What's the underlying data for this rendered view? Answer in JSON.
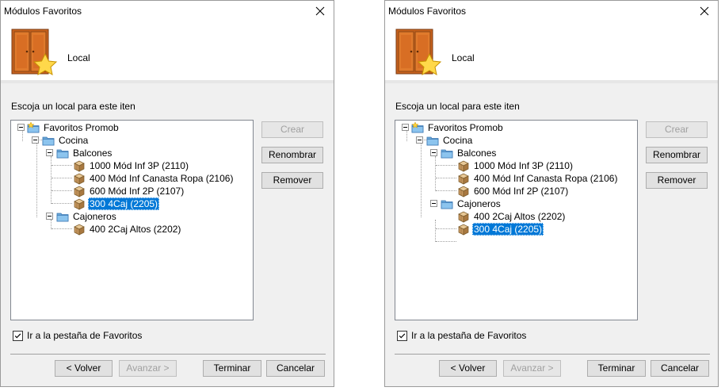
{
  "left_dialog": {
    "title": "Módulos Favoritos",
    "local_label": "Local",
    "instruction": "Escoja un local para este iten",
    "tree": {
      "root": "Favoritos Promob",
      "cocina": "Cocina",
      "balcones": "Balcones",
      "balcones_items": [
        "1000 Mód Inf 3P (2110)",
        "400 Mód Inf Canasta Ropa (2106)",
        "600 Mód Inf 2P (2107)",
        "300 4Caj (2205)"
      ],
      "cajoneros": "Cajoneros",
      "cajoneros_items": [
        "400 2Caj Altos (2202)"
      ],
      "selected": "300 4Caj (2205)"
    },
    "buttons": {
      "crear": "Crear",
      "renombrar": "Renombrar",
      "remover": "Remover"
    },
    "checkbox": {
      "label": "Ir a la pestaña de Favoritos",
      "checked": true
    },
    "footer": {
      "volver": "< Volver",
      "avanzar": "Avanzar >",
      "terminar": "Terminar",
      "cancelar": "Cancelar"
    }
  },
  "right_dialog": {
    "title": "Módulos Favoritos",
    "local_label": "Local",
    "instruction": "Escoja un local para este iten",
    "tree": {
      "root": "Favoritos Promob",
      "cocina": "Cocina",
      "balcones": "Balcones",
      "balcones_items": [
        "1000 Mód Inf 3P (2110)",
        "400 Mód Inf Canasta Ropa (2106)",
        "600 Mód Inf 2P (2107)"
      ],
      "cajoneros": "Cajoneros",
      "cajoneros_items": [
        "400 2Caj Altos (2202)",
        "300 4Caj (2205)"
      ],
      "selected": "300 4Caj (2205)"
    },
    "buttons": {
      "crear": "Crear",
      "renombrar": "Renombrar",
      "remover": "Remover"
    },
    "checkbox": {
      "label": "Ir a la pestaña de Favoritos",
      "checked": true
    },
    "footer": {
      "volver": "< Volver",
      "avanzar": "Avanzar >",
      "terminar": "Terminar",
      "cancelar": "Cancelar"
    }
  },
  "icons": {
    "close": "close-icon",
    "wardrobe": "wardrobe-star-icon",
    "folder": "folder-icon",
    "module": "module-box-icon",
    "star_folder": "favorites-folder-icon"
  },
  "colors": {
    "selection": "#0078d7",
    "button_bg": "#e1e1e1",
    "dialog_bg": "#f0f0f0"
  }
}
